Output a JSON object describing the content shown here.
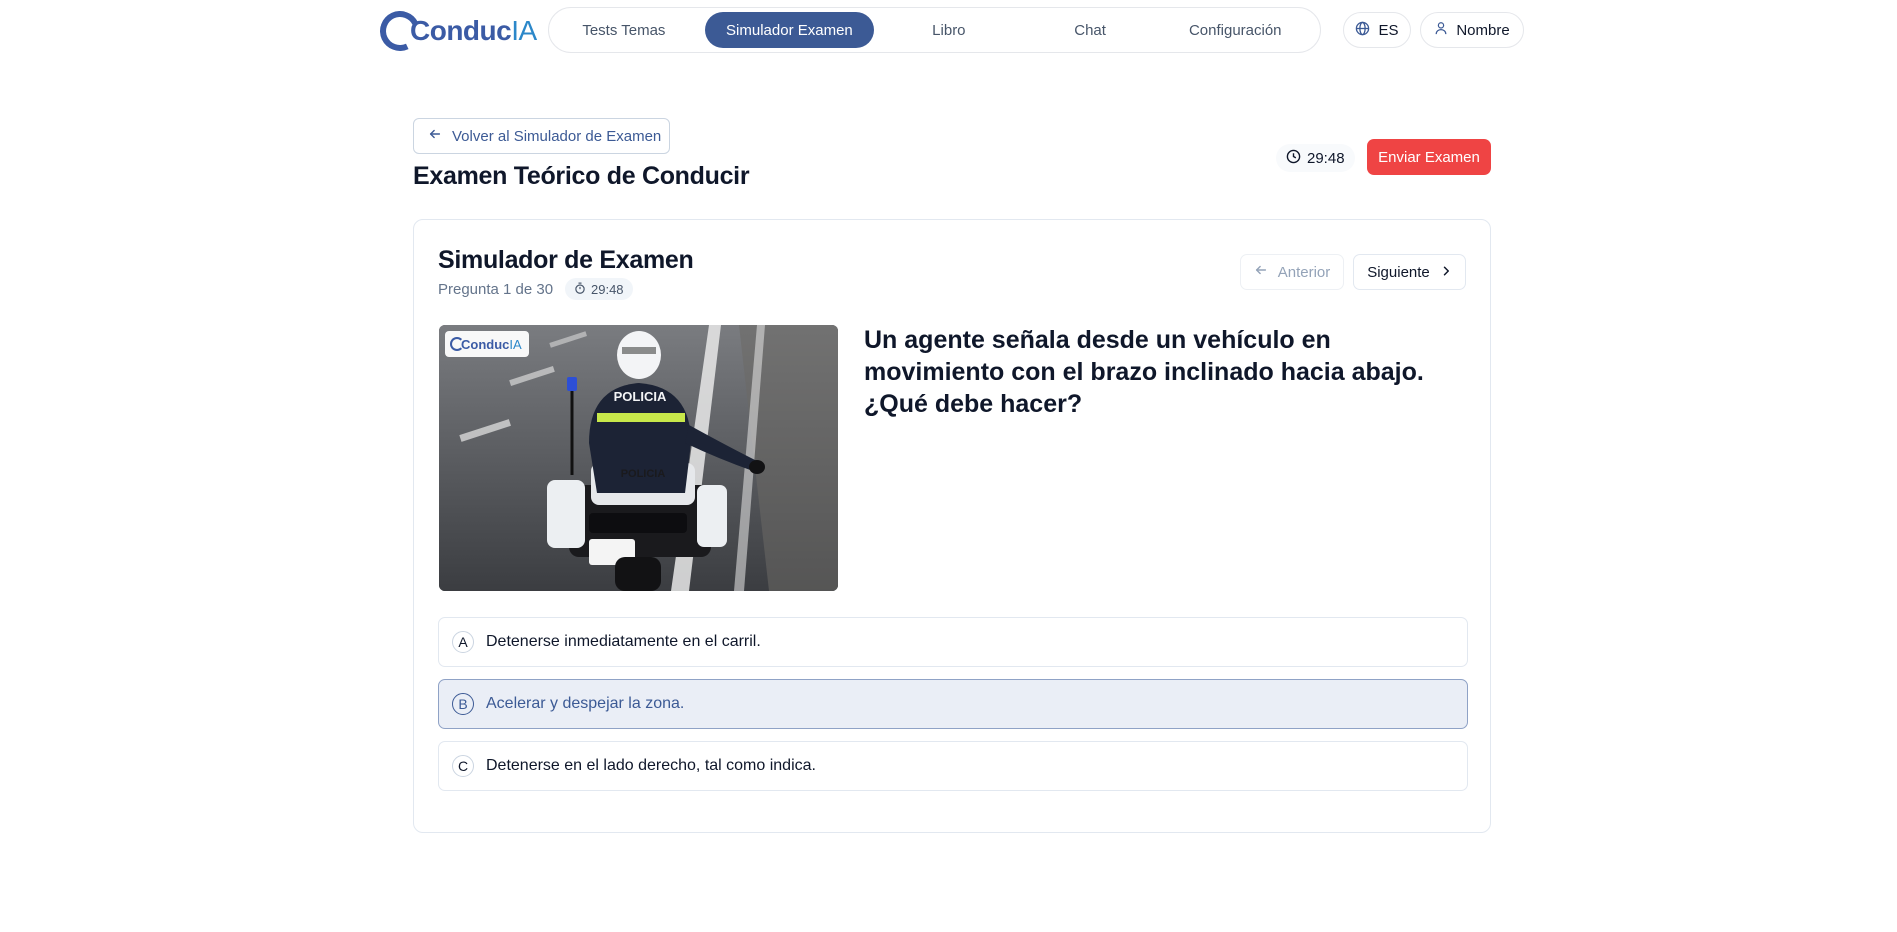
{
  "header": {
    "logo_main": "Conduc",
    "logo_accent": "IA",
    "nav": [
      {
        "label": "Tests Temas",
        "active": false
      },
      {
        "label": "Simulador Examen",
        "active": true
      },
      {
        "label": "Libro",
        "active": false
      },
      {
        "label": "Chat",
        "active": false
      },
      {
        "label": "Configuración",
        "active": false
      }
    ],
    "language": "ES",
    "user": "Nombre"
  },
  "page": {
    "back_label": "Volver al Simulador de Examen",
    "title": "Examen Teórico de Conducir",
    "timer": "29:48",
    "submit_label": "Enviar Examen"
  },
  "card": {
    "title": "Simulador de Examen",
    "progress": "Pregunta 1 de 30",
    "timer": "29:48",
    "prev_label": "Anterior",
    "next_label": "Siguiente",
    "image_text": {
      "logo_main": "Conduc",
      "logo_accent": "IA",
      "jacket_text": "POLICIA",
      "bike_text": "POLICIA"
    },
    "question": "Un agente señala desde un vehículo en movimiento con el brazo inclinado hacia abajo. ¿Qué debe hacer?",
    "options": [
      {
        "letter": "A",
        "text": "Detenerse inmediatamente en el carril.",
        "selected": false
      },
      {
        "letter": "B",
        "text": "Acelerar y despejar la zona.",
        "selected": true
      },
      {
        "letter": "C",
        "text": "Detenerse en el lado derecho, tal como indica.",
        "selected": false
      }
    ]
  },
  "colors": {
    "brand": "#3c5a95",
    "danger": "#ef4444",
    "border": "#e2e8f0"
  },
  "icons": {
    "language": "globe-icon",
    "user": "user-icon",
    "back": "arrow-left-icon",
    "timer": "clock-icon",
    "stopwatch": "stopwatch-icon",
    "next": "chevron-right-icon"
  }
}
